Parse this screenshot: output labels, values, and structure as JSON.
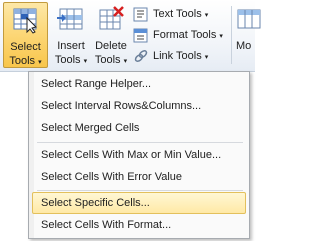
{
  "ribbon": {
    "select_tools": {
      "line1": "Select",
      "line2": "Tools",
      "caret": "▾"
    },
    "insert_tools": {
      "line1": "Insert",
      "line2": "Tools",
      "caret": "▾"
    },
    "delete_tools": {
      "line1": "Delete",
      "line2": "Tools",
      "caret": "▾"
    },
    "more_tools": {
      "line1": "Mo"
    },
    "text_tools": {
      "label": "Text Tools",
      "caret": "▾"
    },
    "format_tools": {
      "label": "Format Tools",
      "caret": "▾"
    },
    "link_tools": {
      "label": "Link Tools",
      "caret": "▾"
    }
  },
  "menu": {
    "items": [
      {
        "label": "Select Range Helper..."
      },
      {
        "label": "Select Interval Rows&Columns..."
      },
      {
        "label": "Select Merged Cells"
      },
      {
        "label": "Select Cells With Max or Min Value..."
      },
      {
        "label": "Select Cells With Error Value"
      },
      {
        "label": "Select Specific Cells..."
      },
      {
        "label": "Select Cells With Format..."
      }
    ]
  },
  "colors": {
    "active_button": "#f8c64c",
    "menu_highlight": "#ffe9a6",
    "menu_border": "#a7abb0"
  }
}
